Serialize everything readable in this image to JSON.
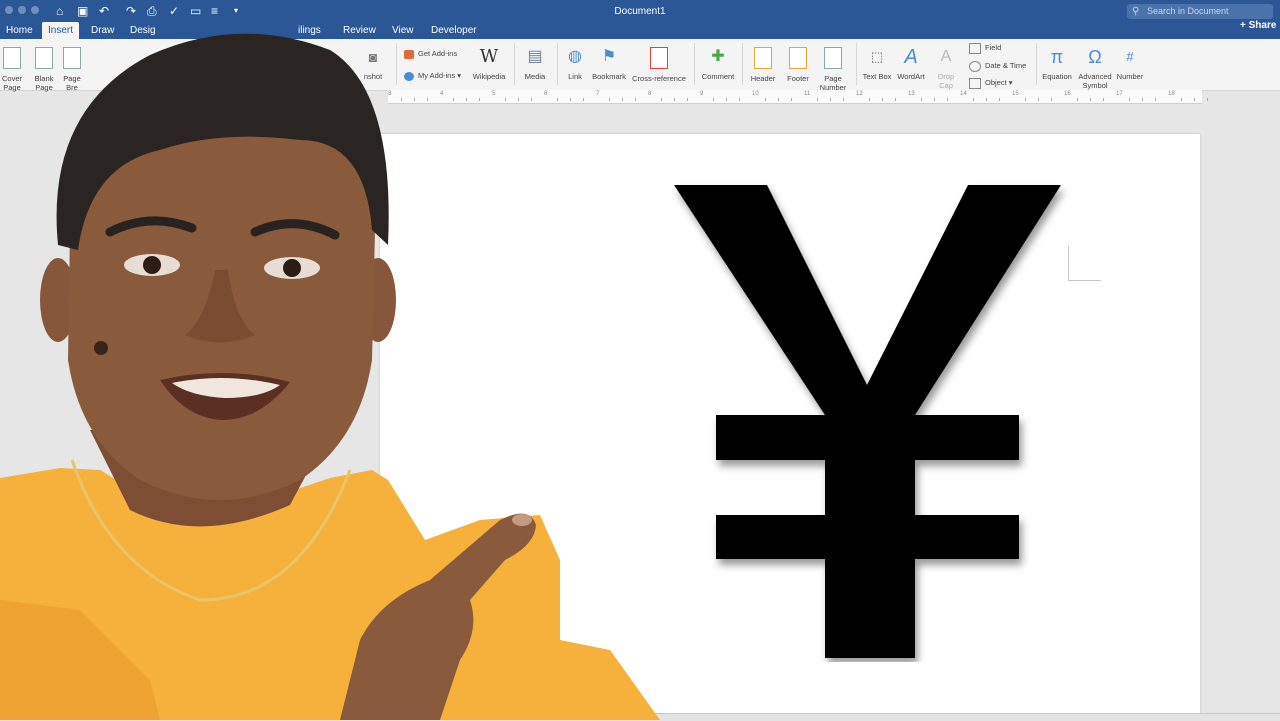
{
  "window": {
    "title": "Document1",
    "search_placeholder": "Search in Document",
    "share_label": "Share"
  },
  "tabs": {
    "home": "Home",
    "insert": "Insert",
    "draw": "Draw",
    "design": "Desig",
    "mailings": "ilings",
    "review": "Review",
    "view": "View",
    "developer": "Developer"
  },
  "ribbon": {
    "cover_page": "Cover\nPage",
    "blank_page": "Blank\nPage",
    "page_break": "Page\nBre",
    "screenshot": "nshot",
    "get_addins": "Get Add-ins",
    "my_addins": "My Add-ins",
    "wikipedia": "Wikipedia",
    "media": "Media",
    "link": "Link",
    "bookmark": "Bookmark",
    "cross_reference": "Cross-reference",
    "comment": "Comment",
    "header": "Header",
    "footer": "Footer",
    "page_number": "Page\nNumber",
    "text_box": "Text Box",
    "wordart": "WordArt",
    "drop_cap": "Drop\nCap",
    "field": "Field",
    "date_time": "Date & Time",
    "object": "Object",
    "equation": "Equation",
    "advanced_symbol": "Advanced\nSymbol",
    "number": "Number"
  },
  "ruler": [
    "3",
    "4",
    "5",
    "6",
    "7",
    "8",
    "9",
    "10",
    "11",
    "12",
    "13",
    "14",
    "15",
    "16",
    "17",
    "18"
  ],
  "document": {
    "symbol": "¥"
  },
  "colors": {
    "titlebar": "#2b5797",
    "ribbon": "#f4f4f4",
    "shirt": "#f6b13c",
    "skin": "#8a5a3c"
  }
}
